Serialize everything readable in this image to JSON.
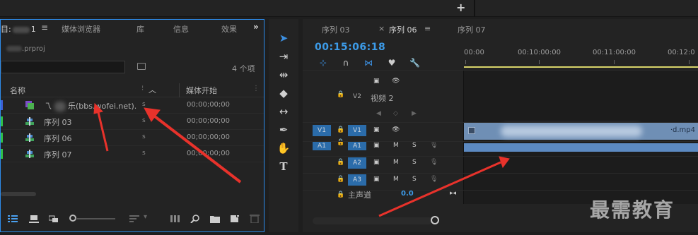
{
  "project_panel": {
    "tabs": [
      {
        "label": "目:",
        "suffix": "1",
        "active": true
      },
      {
        "label": "媒体浏览器"
      },
      {
        "label": "库"
      },
      {
        "label": "信息"
      },
      {
        "label": "效果"
      }
    ],
    "project_file": ".prproj",
    "item_count": "4 个项",
    "columns": {
      "name": "名称",
      "media_start": "媒体开始"
    },
    "rows": [
      {
        "label": "乐(bbs.wofei.net).",
        "prefix": "乁",
        "fps": "s",
        "timecode": "00;00;00;00",
        "color": "#3d5fd6",
        "icon": "multicam-icon"
      },
      {
        "label": "序列 03",
        "fps": "s",
        "timecode": "00;00;00;00",
        "color": "#2fbf4a",
        "icon": "sequence-icon"
      },
      {
        "label": "序列 06",
        "fps": "s",
        "timecode": "00;00;00;00",
        "color": "#2fbf4a",
        "icon": "sequence-icon"
      },
      {
        "label": "序列 07",
        "fps": "s",
        "timecode": "00;00;00;00",
        "color": "#2fbf4a",
        "icon": "sequence-icon"
      }
    ]
  },
  "timeline": {
    "tabs": [
      {
        "label": "序列 03"
      },
      {
        "label": "序列 06",
        "active": true
      },
      {
        "label": "序列 07"
      }
    ],
    "timecode": "00:15:06:18",
    "ruler_labels": [
      "00:00",
      "00:10:00:00",
      "00:11:00:00",
      "00:12:0"
    ],
    "tracks": {
      "v2": {
        "label": "V2",
        "name": "视频 2"
      },
      "v1": {
        "source": "V1",
        "label": "V1"
      },
      "a1": {
        "source": "A1",
        "label": "A1"
      },
      "a2": {
        "label": "A2"
      },
      "a3": {
        "label": "A3"
      }
    },
    "mute": "M",
    "solo": "S",
    "master_label": "主声道",
    "master_value": "0.0",
    "clip_name": "·d.mp4"
  },
  "watermark": "最需教育",
  "colors": {
    "accent": "#2d8ceb",
    "timecode": "#3c9be8",
    "annotation_arrow": "#e8322b",
    "clip_video": "#6f8fb5",
    "clip_audio": "#5c8ac2"
  }
}
